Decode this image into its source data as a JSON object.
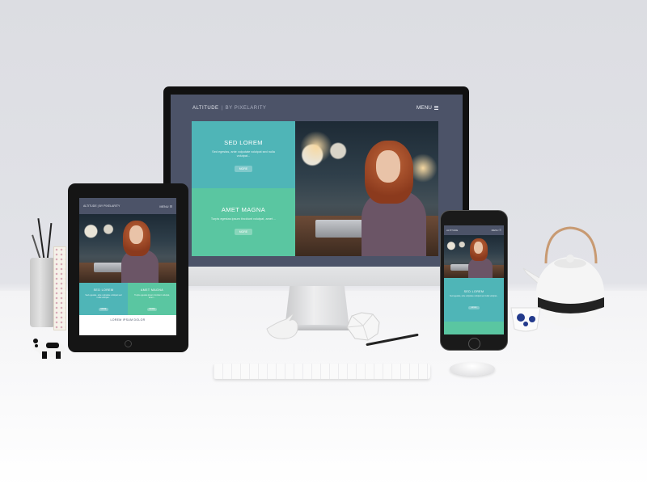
{
  "scene": "responsive website mockup on desk",
  "site": {
    "brand": "ALTITUDE",
    "tagline": "BY PIXELARITY",
    "menu_label": "MENU",
    "panels": [
      {
        "heading": "SED LOREM",
        "text": "Sed egestas, ante vulputate volutpat sed nulla volutpat...",
        "button": "MORE"
      },
      {
        "heading": "AMET MAGNA",
        "text": "Turpis egestas ipsum tincidunt volutpat, amet ...",
        "button": "MORE"
      }
    ],
    "footer_heading": "LOREM IPSUM DOLOR"
  },
  "colors": {
    "site_bg": "#4c5368",
    "teal": "#4fb5b7",
    "green": "#5ac6a1"
  }
}
